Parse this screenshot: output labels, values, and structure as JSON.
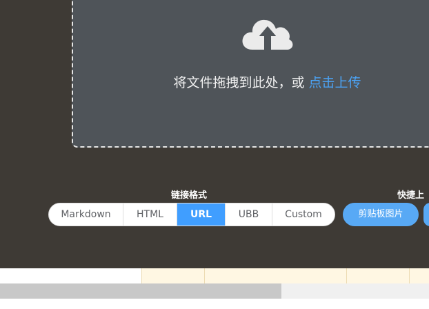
{
  "upload": {
    "prompt": "将文件拖拽到此处，或",
    "link": "点击上传",
    "icon": "cloud-upload-icon"
  },
  "link_format": {
    "label": "链接格式",
    "options": [
      "Markdown",
      "HTML",
      "URL",
      "UBB",
      "Custom"
    ],
    "selected": "URL"
  },
  "quick_upload": {
    "label": "快捷上",
    "clipboard_button": "剪贴板图片"
  },
  "colors": {
    "background": "#3e3a35",
    "dropzone": "#4f5459",
    "accent": "#409eff",
    "link": "#4ba3f5"
  }
}
